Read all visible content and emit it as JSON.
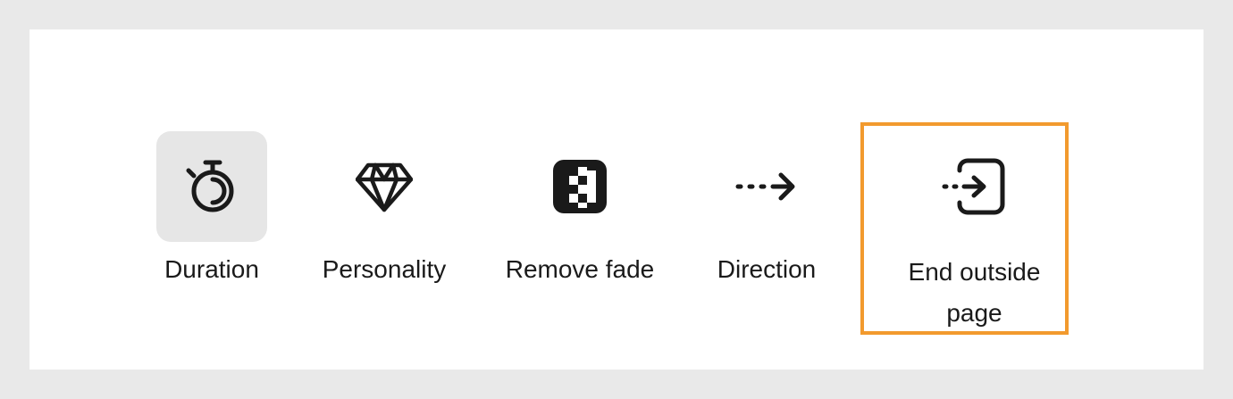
{
  "options": [
    {
      "id": "duration",
      "label": "Duration",
      "icon": "stopwatch-icon",
      "selected": true
    },
    {
      "id": "personality",
      "label": "Personality",
      "icon": "diamond-icon",
      "selected": false
    },
    {
      "id": "remove_fade",
      "label": "Remove fade",
      "icon": "fade-checker-icon",
      "selected": false
    },
    {
      "id": "direction",
      "label": "Direction",
      "icon": "dashed-arrow-right-icon",
      "selected": false
    },
    {
      "id": "end_outside_page",
      "label_line1": "End outside",
      "label_line2": "page",
      "icon": "exit-page-icon",
      "selected": false,
      "highlighted": true
    }
  ],
  "colors": {
    "background": "#e9e9e9",
    "panel": "#ffffff",
    "selected_bg": "#e6e6e6",
    "icon": "#1a1a1a",
    "highlight": "#f29a2e"
  }
}
